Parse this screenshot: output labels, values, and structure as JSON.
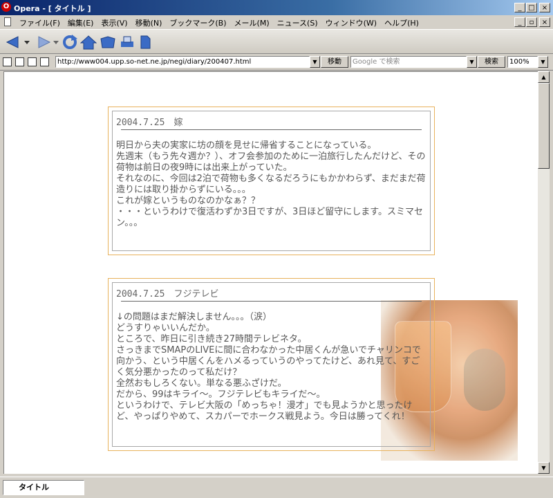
{
  "window": {
    "title": "Opera - [ タイトル ]",
    "logo_glyph": "O",
    "controls": {
      "minimize": "_",
      "maximize": "□",
      "close": "×",
      "restore": "▫"
    }
  },
  "menu": {
    "items": [
      "ファイル(F)",
      "編集(E)",
      "表示(V)",
      "移動(N)",
      "ブックマーク(B)",
      "メール(M)",
      "ニュース(S)",
      "ウィンドウ(W)",
      "ヘルプ(H)"
    ]
  },
  "toolbar": {
    "buttons": [
      "back-icon",
      "forward-icon",
      "reload-icon",
      "home-icon",
      "hotlist-icon",
      "print-icon",
      "document-icon"
    ]
  },
  "address": {
    "url": "http://www004.upp.so-net.ne.jp/negi/diary/200407.html",
    "go_label": "移動",
    "search_placeholder": "Google で検索",
    "search_label": "検索",
    "zoom": "100%"
  },
  "entries": [
    {
      "date_title": "2004.7.25　嫁",
      "body": "明日から夫の実家に坊の顔を見せに帰省することになっている。\n先週末（もう先々週か？）、オフ会参加のために一泊旅行したんだけど、その荷物は前日の夜9時には出来上がっていた。\nそれなのに、今回は2泊で荷物も多くなるだろうにもかかわらず、まだまだ荷造りには取り掛からずにいる。。。\nこれが嫁というものなのかなぁ？？\n・・・というわけで復活わずか3日ですが、3日ほど留守にします。スミマセン。。。"
    },
    {
      "date_title": "2004.7.25　フジテレビ",
      "body": "↓の問題はまだ解決しません。。。（涙）\nどうすりゃいいんだか。\nところで、昨日に引き続き27時間テレビネタ。\nさっきまでSMAPのLIVEに間に合わなかった中居くんが急いでチャリンコで向かう、という中居くんをハメるっていうのやってたけど、あれ見て、すごく気分悪かったのって私だけ？\n全然おもしろくない。単なる悪ふざけだ。\nだから、99はキライ～。フジテレビもキライだ～。\nというわけで、テレビ大阪の「めっちゃ！漫才」でも見ようかと思ったけど、やっぱりやめて、スカパーでホークス戦見よう。今日は勝ってくれ！"
    }
  ],
  "status": {
    "tab_label": "タイトル"
  }
}
